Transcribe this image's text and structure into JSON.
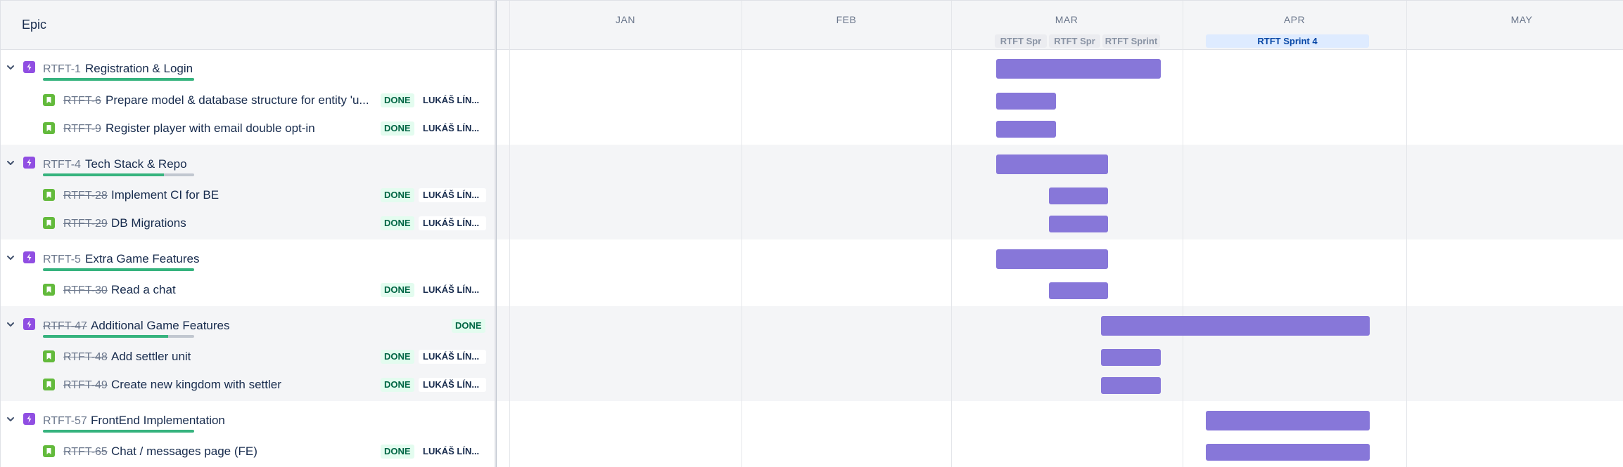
{
  "header": {
    "column_title": "Epic",
    "months": [
      "JAN",
      "FEB",
      "MAR",
      "APR",
      "MAY"
    ],
    "sprints": [
      {
        "label": "RTFT Spr",
        "state": "past"
      },
      {
        "label": "RTFT Spr",
        "state": "past"
      },
      {
        "label": "RTFT Sprint",
        "state": "past"
      },
      {
        "label": "RTFT Sprint 4",
        "state": "active"
      }
    ]
  },
  "rows": [
    {
      "type": "epic",
      "key": "RTFT-1",
      "summary": "Registration & Login",
      "progress_done": 1.0,
      "key_done": false
    },
    {
      "type": "story",
      "key": "RTFT-6",
      "summary": "Prepare model & database structure for entity 'u...",
      "status": "DONE",
      "assignee": "LUKÁŠ LÍN..."
    },
    {
      "type": "story",
      "key": "RTFT-9",
      "summary": "Register player with email double opt-in",
      "status": "DONE",
      "assignee": "LUKÁŠ LÍN..."
    },
    {
      "type": "epic",
      "key": "RTFT-4",
      "summary": "Tech Stack & Repo",
      "progress_done": 0.8,
      "key_done": false
    },
    {
      "type": "story",
      "key": "RTFT-28",
      "summary": "Implement CI for BE",
      "status": "DONE",
      "assignee": "LUKÁŠ LÍN..."
    },
    {
      "type": "story",
      "key": "RTFT-29",
      "summary": "DB Migrations",
      "status": "DONE",
      "assignee": "LUKÁŠ LÍN..."
    },
    {
      "type": "epic",
      "key": "RTFT-5",
      "summary": "Extra Game Features",
      "progress_done": 1.0,
      "key_done": false
    },
    {
      "type": "story",
      "key": "RTFT-30",
      "summary": "Read a chat",
      "status": "DONE",
      "assignee": "LUKÁŠ LÍN..."
    },
    {
      "type": "epic",
      "key": "RTFT-47",
      "summary": "Additional Game Features",
      "progress_done": 0.83,
      "key_done": true,
      "status": "DONE"
    },
    {
      "type": "story",
      "key": "RTFT-48",
      "summary": "Add settler unit",
      "status": "DONE",
      "assignee": "LUKÁŠ LÍN..."
    },
    {
      "type": "story",
      "key": "RTFT-49",
      "summary": "Create new kingdom with settler",
      "status": "DONE",
      "assignee": "LUKÁŠ LÍN..."
    },
    {
      "type": "epic",
      "key": "RTFT-57",
      "summary": "FrontEnd Implementation",
      "progress_done": 1.0,
      "key_done": false
    },
    {
      "type": "story",
      "key": "RTFT-65",
      "summary": "Chat / messages page (FE)",
      "status": "DONE",
      "assignee": "LUKÁŠ LÍN..."
    }
  ],
  "colors": {
    "bar": "#8777d9",
    "epic_icon": "#904ee2",
    "story_icon": "#63ba3c",
    "progress": "#36b37e",
    "done_lozenge_bg": "#e3fcef",
    "done_lozenge_text": "#006644"
  }
}
